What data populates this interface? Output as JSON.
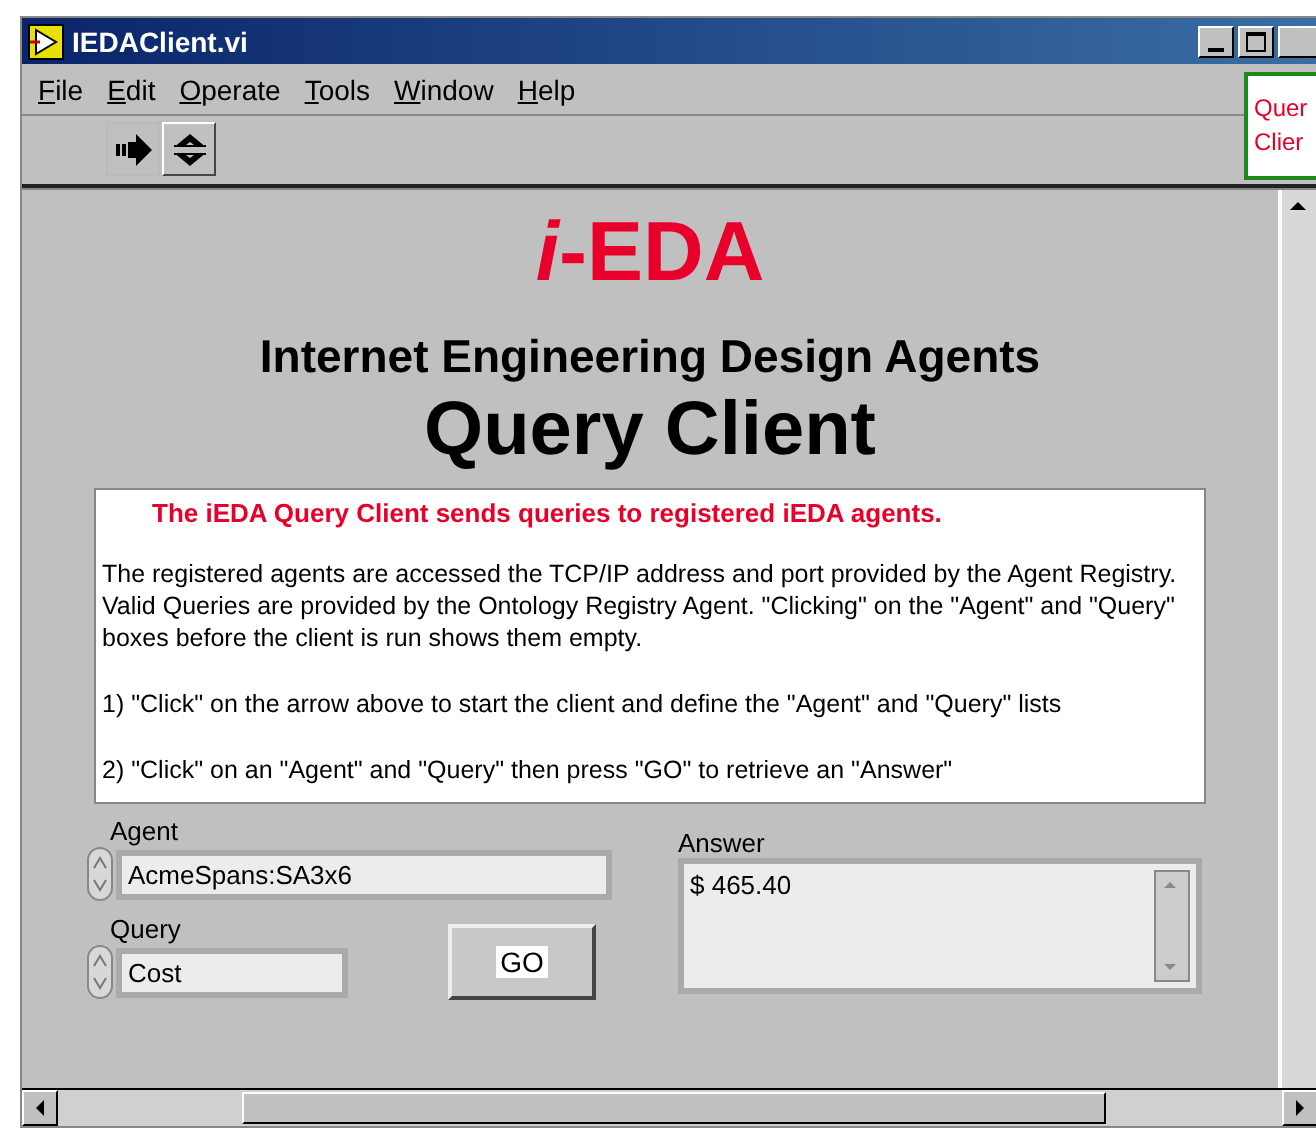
{
  "window": {
    "title": "IEDAClient.vi"
  },
  "menu": [
    {
      "label": "File"
    },
    {
      "label": "Edit"
    },
    {
      "label": "Operate"
    },
    {
      "label": "Tools"
    },
    {
      "label": "Window"
    },
    {
      "label": "Help"
    }
  ],
  "side_note": {
    "lines": [
      "Quer",
      "Clier"
    ]
  },
  "logo": "*i*-EDA",
  "subtitle": "Internet Engineering Design Agents",
  "title": "Query Client",
  "description": {
    "heading": "The iEDA Query Client sends queries to registered iEDA agents.",
    "paragraphs": [
      "The registered agents are accessed the TCP/IP address and port provided by the Agent Registry.   Valid Queries are provided by the Ontology Registry Agent.  \"Clicking\" on the \"Agent\" and \"Query\" boxes before the client is run shows them empty.",
      "1) \"Click\" on the arrow above to start the client and define the \"Agent\" and \"Query\" lists",
      "2) \"Click\" on an \"Agent\" and \"Query\" then press \"GO\" to retrieve an \"Answer\""
    ]
  },
  "agent": {
    "label": "Agent",
    "value": "AcmeSpans:SA3x6"
  },
  "query": {
    "label": "Query",
    "value": "Cost"
  },
  "go_button": "GO",
  "answer": {
    "label": "Answer",
    "value": "$ 465.40"
  }
}
